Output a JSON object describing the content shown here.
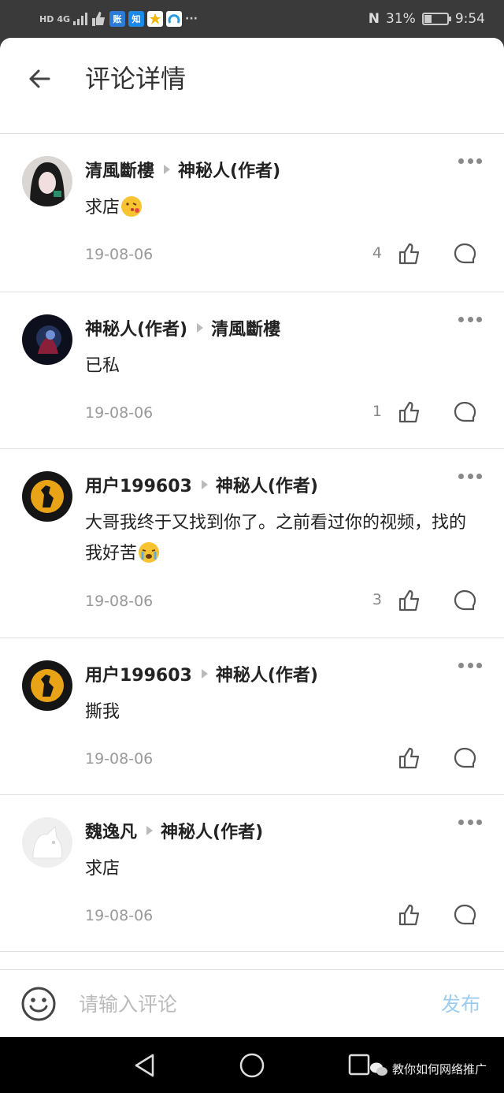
{
  "status_bar": {
    "left_tags": [
      "HD",
      "4G"
    ],
    "app_badges": [
      "账",
      "知"
    ],
    "overflow": "···",
    "nfc": "N",
    "battery_text": "31%",
    "battery_level_percent": 31,
    "time": "9:54"
  },
  "header": {
    "title": "评论详情"
  },
  "comments": [
    {
      "author": "清風斷樓",
      "reply_to": "神秘人(作者)",
      "text": "求店",
      "emoji": true,
      "date": "19-08-06",
      "likes": "4"
    },
    {
      "author": "神秘人(作者)",
      "reply_to": "清風斷樓",
      "text": "已私",
      "emoji": false,
      "date": "19-08-06",
      "likes": "1"
    },
    {
      "author": "用户199603",
      "reply_to": "神秘人(作者)",
      "text": "大哥我终于又找到你了。之前看过你的视频，找的我好苦",
      "emoji": true,
      "date": "19-08-06",
      "likes": "3"
    },
    {
      "author": "用户199603",
      "reply_to": "神秘人(作者)",
      "text": "撕我",
      "emoji": false,
      "date": "19-08-06",
      "likes": ""
    },
    {
      "author": "魏逸凡",
      "reply_to": "神秘人(作者)",
      "text": "求店",
      "emoji": false,
      "date": "19-08-06",
      "likes": ""
    }
  ],
  "input_bar": {
    "placeholder": "请输入评论",
    "publish_label": "发布"
  },
  "watermark": {
    "text": "教你如何网络推广"
  },
  "colors": {
    "publish": "#9ccdee",
    "date": "#999999",
    "background": "#ffffff"
  }
}
